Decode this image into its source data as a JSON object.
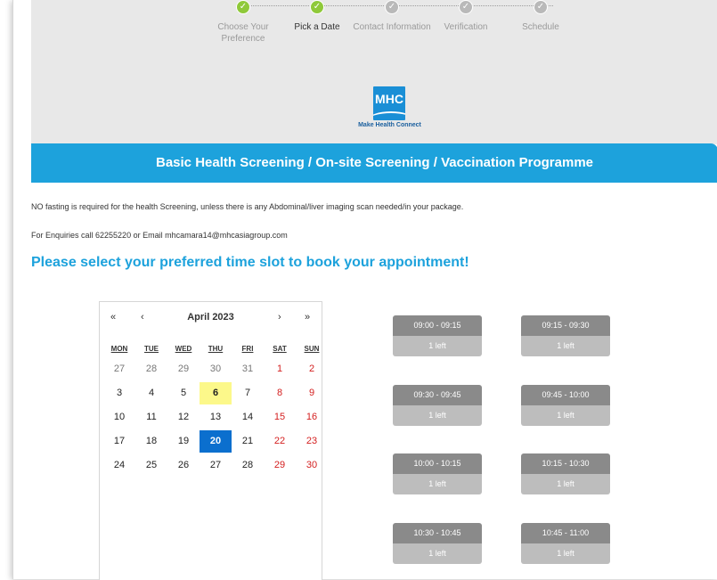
{
  "steps": [
    {
      "label": "Choose Your Preference",
      "status": "done"
    },
    {
      "label": "Pick a Date",
      "status": "current"
    },
    {
      "label": "Contact Information",
      "status": "pending"
    },
    {
      "label": "Verification",
      "status": "pending"
    },
    {
      "label": "Schedule",
      "status": "pending"
    }
  ],
  "logo": {
    "text": "MHC",
    "tagline": "Make Health Connect"
  },
  "banner_title": "Basic Health Screening / On-site Screening / Vaccination Programme",
  "note_fasting": "NO fasting is required for the health Screening, unless there is any Abdominal/liver imaging scan needed/in your package.",
  "note_enquiries": "For Enquiries call 62255220 or Email mhcamara14@mhcasiagroup.com",
  "cta": "Please select your preferred time slot to book your appointment!",
  "calendar": {
    "month_label": "April 2023",
    "nav": {
      "prev_year": "«",
      "prev_month": "‹",
      "next_month": "›",
      "next_year": "»"
    },
    "weekdays": [
      "MON",
      "TUE",
      "WED",
      "THU",
      "FRI",
      "SAT",
      "SUN"
    ],
    "weeks": [
      [
        "27",
        "28",
        "29",
        "30",
        "31",
        "1",
        "2"
      ],
      [
        "3",
        "4",
        "5",
        "6",
        "7",
        "8",
        "9"
      ],
      [
        "10",
        "11",
        "12",
        "13",
        "14",
        "15",
        "16"
      ],
      [
        "17",
        "18",
        "19",
        "20",
        "21",
        "22",
        "23"
      ],
      [
        "24",
        "25",
        "26",
        "27",
        "28",
        "29",
        "30"
      ]
    ],
    "today": "6",
    "selected": "20",
    "weekend_color": "#d42020",
    "selected_color": "#0b6fce",
    "today_color": "#fcf88a"
  },
  "slots": [
    {
      "time": "09:00 - 09:15",
      "avail": "1 left"
    },
    {
      "time": "09:15 - 09:30",
      "avail": "1 left"
    },
    {
      "time": "09:30 - 09:45",
      "avail": "1 left"
    },
    {
      "time": "09:45 - 10:00",
      "avail": "1 left"
    },
    {
      "time": "10:00 - 10:15",
      "avail": "1 left"
    },
    {
      "time": "10:15 - 10:30",
      "avail": "1 left"
    },
    {
      "time": "10:30 - 10:45",
      "avail": "1 left"
    },
    {
      "time": "10:45 - 11:00",
      "avail": "1 left"
    }
  ],
  "colors": {
    "brand_blue": "#1da2dc",
    "step_done": "#8fc93a"
  }
}
